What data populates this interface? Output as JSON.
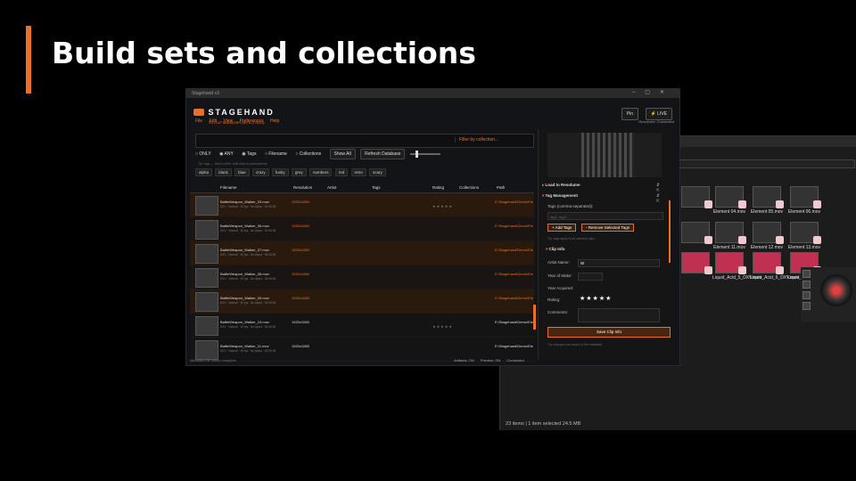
{
  "slide": {
    "title": "Build sets and collections"
  },
  "explorer": {
    "row1": [
      "",
      "Element 04.mov",
      "Element 05.mov",
      "Element 06.mov"
    ],
    "row2": [
      "",
      "Element 11.mov",
      "Element 12.mov",
      "Element 13.mov"
    ],
    "row3": [
      "",
      "Liquid_Acid_5_DXV.mov",
      "Liquid_Acid_6_DXV.mov",
      "Liquid_Blend_2_DXV.mov"
    ],
    "status": "23 items  |  1 item selected  24.5 MB"
  },
  "app": {
    "titlebar": "Stagehand v3",
    "brand": {
      "name": "STAGEHAND",
      "sub": "V3 CLIP MANAGER  BETA (TODO)"
    },
    "menu": [
      "File",
      "Edit",
      "View",
      "Preferences",
      "Help"
    ],
    "pin_label": "Pin",
    "live_label": "LIVE",
    "connection": "Resolume: Connected",
    "filter_placeholder": "Filter by collection...",
    "options": {
      "only": "ONLY",
      "any": "ANY",
      "tags": "Tags",
      "filename": "Filename",
      "collections": "Collections",
      "show_all": "Show All",
      "refresh": "Refresh Database"
    },
    "tag_hint": "Tip: tags — click to filter, shift-click to add/subtract",
    "tags": [
      "alpha",
      "black",
      "blue",
      "crazy",
      "funky",
      "grey",
      "numbers",
      "red",
      "retro",
      "scary"
    ],
    "columns": [
      "Filename",
      "Resolution",
      "Artist",
      "Tags",
      "Rating",
      "Collections",
      "Path"
    ],
    "rows": [
      {
        "file": "BattleWeapon_Walker_03.mov",
        "meta": "DXV · Normal · 30 fps · No Alpha · 00:00:08",
        "res": "1920x1080",
        "rating": "★★★★★",
        "path": "E:\\Stagehand\\Demo\\Ele"
      },
      {
        "file": "BattleWeapon_Walker_06.mov",
        "meta": "DXV · Normal · 30 fps · No Alpha · 00:00:08",
        "res": "1920x1080",
        "rating": "",
        "path": "E:\\Stagehand\\Demo\\Ele"
      },
      {
        "file": "BattleWeapon_Walker_07.mov",
        "meta": "DXV · Normal · 30 fps · No Alpha · 00:00:08",
        "res": "1920x1080",
        "rating": "",
        "path": "E:\\Stagehand\\Demo\\Ele"
      },
      {
        "file": "BattleWeapon_Walker_08.mov",
        "meta": "DXV · Normal · 30 fps · No Alpha · 00:00:08",
        "res": "1920x1080",
        "rating": "",
        "path": "E:\\Stagehand\\Demo\\Ele"
      },
      {
        "file": "BattleWeapon_Walker_09.mov",
        "meta": "DXV · Normal · 30 fps · No Alpha · 00:00:08",
        "res": "1920x1080",
        "rating": "",
        "path": "E:\\Stagehand\\Demo\\Ele"
      },
      {
        "file": "BattleWeapon_Walker_10.mov",
        "meta": "DXV · Normal · 30 fps · No Alpha · 00:00:08",
        "res": "1920x1080",
        "rating": "★★★★★",
        "path": "E:\\Stagehand\\Demo\\Ele"
      },
      {
        "file": "BattleWeapon_Walker_11.mov",
        "meta": "DXV · Normal · 30 fps · No Alpha · 00:00:08",
        "res": "1920x1080",
        "rating": "",
        "path": "E:\\Stagehand\\Demo\\Ele"
      }
    ],
    "status_left": "Metadata file writes complete",
    "status_right": [
      "Artifacts: ON",
      "Preview: ON",
      "Connected"
    ]
  },
  "panel": {
    "load_section": "Load to Resolume",
    "tag_section": "Tag Management",
    "tags_label": "Tags (comma-separated):",
    "tags_placeholder": "tag1, tag2...",
    "add_tags": "+ Add Tags",
    "remove_tags": "- Remove Selected Tags",
    "tag_note": "Tip: tags apply to all selected clips",
    "clip_section": "Clip Info",
    "artist_label": "Artist Name:",
    "artist_value": "W",
    "year_label": "Year of Make:",
    "acquired_label": "Year Acquired:",
    "rating_label": "Rating:",
    "rating_value": "★★★★★",
    "comments_label": "Comments:",
    "save": "Save Clip Info",
    "save_hint": "Tip: changes are saved to file metadata"
  },
  "colors": {
    "accent": "#e8702a",
    "background": "#000000",
    "panel": "#131417"
  }
}
